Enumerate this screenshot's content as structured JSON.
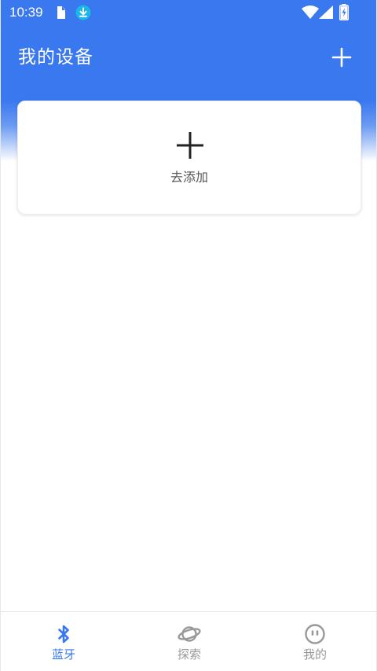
{
  "status_bar": {
    "time": "10:39",
    "icons": [
      "sd-card-icon",
      "download-icon",
      "wifi-icon",
      "signal-icon",
      "battery-charging-icon"
    ]
  },
  "header": {
    "title": "我的设备",
    "add_icon": "plus-icon"
  },
  "add_card": {
    "icon": "plus-icon",
    "label": "去添加"
  },
  "bottom_nav": {
    "items": [
      {
        "label": "蓝牙",
        "icon": "bluetooth-icon",
        "active": true
      },
      {
        "label": "探索",
        "icon": "planet-icon",
        "active": false
      },
      {
        "label": "我的",
        "icon": "face-icon",
        "active": false
      }
    ]
  },
  "colors": {
    "primary": "#3a78f0",
    "inactive": "#999999",
    "card_text": "#555555",
    "download_badge": "#19b8e6"
  }
}
